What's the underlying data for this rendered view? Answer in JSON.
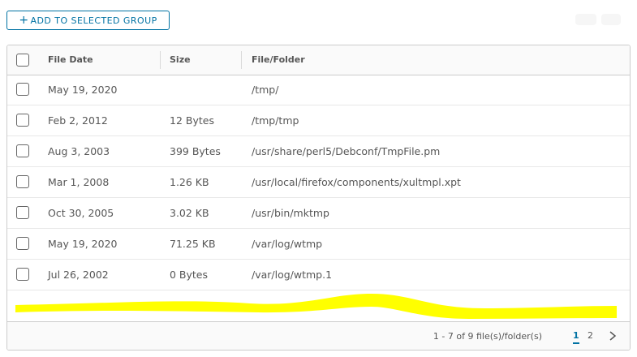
{
  "toolbar": {
    "add_button_label": "ADD TO SELECTED GROUP",
    "add_button_icon": "plus-icon"
  },
  "table": {
    "columns": [
      "File Date",
      "Size",
      "File/Folder"
    ],
    "rows": [
      {
        "date": "May 19, 2020",
        "size": "",
        "path": "/tmp/"
      },
      {
        "date": "Feb 2, 2012",
        "size": "12 Bytes",
        "path": "/tmp/tmp"
      },
      {
        "date": "Aug 3, 2003",
        "size": "399 Bytes",
        "path": "/usr/share/perl5/Debconf/TmpFile.pm"
      },
      {
        "date": "Mar 1, 2008",
        "size": "1.26 KB",
        "path": "/usr/local/firefox/components/xultmpl.xpt"
      },
      {
        "date": "Oct 30, 2005",
        "size": "3.02 KB",
        "path": "/usr/bin/mktmp"
      },
      {
        "date": "May 19, 2020",
        "size": "71.25 KB",
        "path": "/var/log/wtmp"
      },
      {
        "date": "Jul 26, 2002",
        "size": "0 Bytes",
        "path": "/var/log/wtmp.1"
      }
    ]
  },
  "pagination": {
    "info": "1 - 7 of 9 file(s)/folder(s)",
    "pages": [
      "1",
      "2"
    ],
    "current_page": "1"
  },
  "colors": {
    "accent": "#0072a3",
    "redaction": "#ffff00"
  }
}
